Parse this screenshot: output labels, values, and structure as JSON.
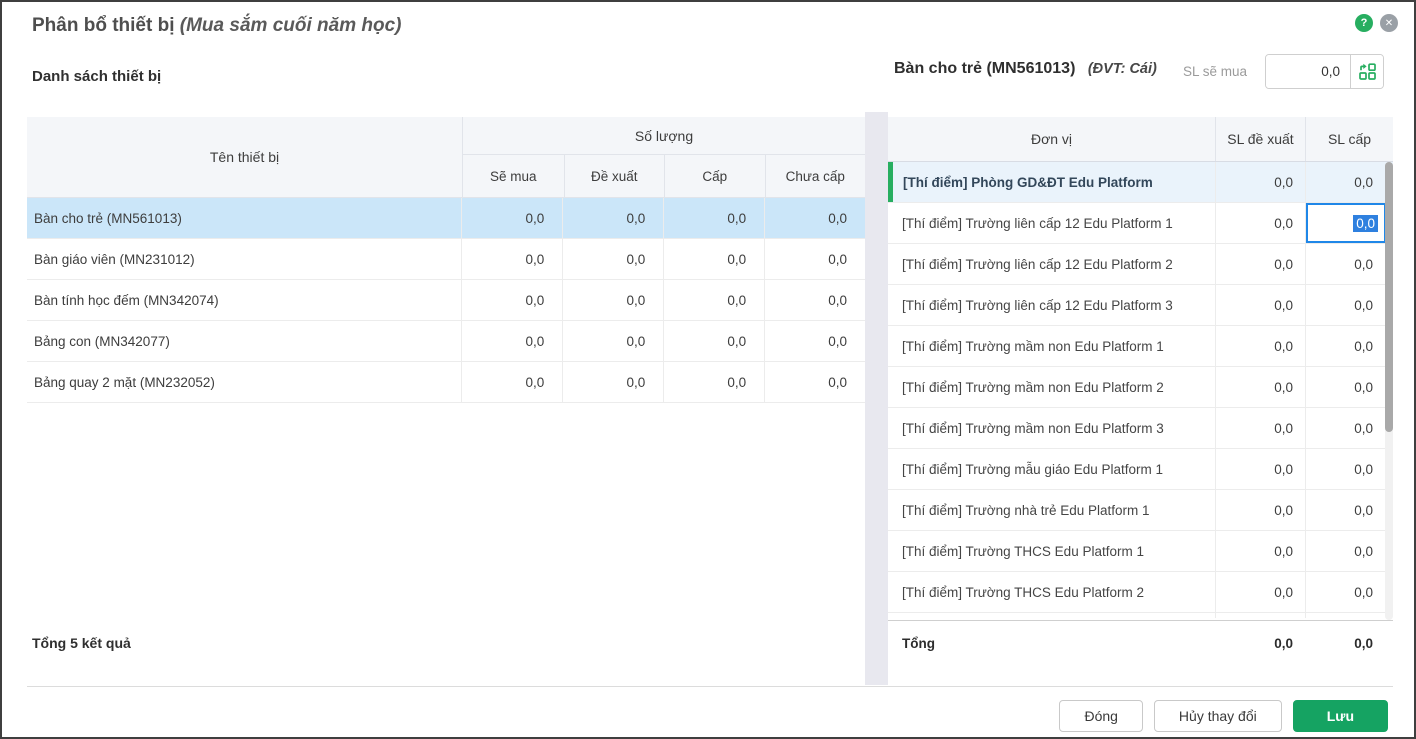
{
  "dialog": {
    "title": "Phân bổ thiết bị",
    "title_suffix": "(Mua sắm cuối năm học)",
    "help_icon": "?",
    "close_icon": "✕"
  },
  "left_panel": {
    "heading": "Danh sách thiết bị",
    "table": {
      "col_name": "Tên thiết bị",
      "col_group": "Số lượng",
      "subcols": [
        "Sẽ mua",
        "Đề xuất",
        "Cấp",
        "Chưa cấp"
      ],
      "rows": [
        {
          "name": "Bàn cho trẻ (MN561013)",
          "se_mua": "0,0",
          "de_xuat": "0,0",
          "cap": "0,0",
          "chua_cap": "0,0",
          "selected": true
        },
        {
          "name": "Bàn giáo viên (MN231012)",
          "se_mua": "0,0",
          "de_xuat": "0,0",
          "cap": "0,0",
          "chua_cap": "0,0",
          "selected": false
        },
        {
          "name": "Bàn tính học đếm (MN342074)",
          "se_mua": "0,0",
          "de_xuat": "0,0",
          "cap": "0,0",
          "chua_cap": "0,0",
          "selected": false
        },
        {
          "name": "Bảng con (MN342077)",
          "se_mua": "0,0",
          "de_xuat": "0,0",
          "cap": "0,0",
          "chua_cap": "0,0",
          "selected": false
        },
        {
          "name": "Bảng quay 2 mặt (MN232052)",
          "se_mua": "0,0",
          "de_xuat": "0,0",
          "cap": "0,0",
          "chua_cap": "0,0",
          "selected": false
        }
      ]
    },
    "footer_total": "Tổng 5 kết quả"
  },
  "right_panel": {
    "device_title": "Bàn cho trẻ (MN561013)",
    "device_unit": "(ĐVT: Cái)",
    "qty_label": "SL sẽ mua",
    "qty_value": "0,0",
    "distribute_icon": "grid-distribute-icon",
    "table": {
      "columns": [
        "Đơn vị",
        "SL đề xuất",
        "SL cấp"
      ],
      "rows": [
        {
          "name": "[Thí điểm] Phòng GD&ĐT Edu Platform",
          "de_xuat": "0,0",
          "cap": "0,0",
          "highlight": true,
          "cap_focused": false
        },
        {
          "name": "[Thí điểm] Trường liên cấp 12 Edu Platform 1",
          "de_xuat": "0,0",
          "cap": "0,0",
          "highlight": false,
          "cap_focused": true
        },
        {
          "name": "[Thí điểm] Trường liên cấp 12 Edu Platform 2",
          "de_xuat": "0,0",
          "cap": "0,0",
          "highlight": false,
          "cap_focused": false
        },
        {
          "name": "[Thí điểm] Trường liên cấp 12 Edu Platform 3",
          "de_xuat": "0,0",
          "cap": "0,0",
          "highlight": false,
          "cap_focused": false
        },
        {
          "name": "[Thí điểm] Trường mầm non Edu Platform 1",
          "de_xuat": "0,0",
          "cap": "0,0",
          "highlight": false,
          "cap_focused": false
        },
        {
          "name": "[Thí điểm] Trường mầm non Edu Platform 2",
          "de_xuat": "0,0",
          "cap": "0,0",
          "highlight": false,
          "cap_focused": false
        },
        {
          "name": "[Thí điểm] Trường mầm non Edu Platform 3",
          "de_xuat": "0,0",
          "cap": "0,0",
          "highlight": false,
          "cap_focused": false
        },
        {
          "name": "[Thí điểm] Trường mẫu giáo Edu Platform 1",
          "de_xuat": "0,0",
          "cap": "0,0",
          "highlight": false,
          "cap_focused": false
        },
        {
          "name": "[Thí điểm] Trường nhà trẻ Edu Platform 1",
          "de_xuat": "0,0",
          "cap": "0,0",
          "highlight": false,
          "cap_focused": false
        },
        {
          "name": "[Thí điểm] Trường THCS Edu Platform 1",
          "de_xuat": "0,0",
          "cap": "0,0",
          "highlight": false,
          "cap_focused": false
        },
        {
          "name": "[Thí điểm] Trường THCS Edu Platform 2",
          "de_xuat": "0,0",
          "cap": "0,0",
          "highlight": false,
          "cap_focused": false
        }
      ],
      "total_label": "Tổng",
      "total_de_xuat": "0,0",
      "total_cap": "0,0"
    }
  },
  "footer": {
    "close_label": "Đóng",
    "cancel_label": "Hủy thay đổi",
    "save_label": "Lưu"
  },
  "colors": {
    "accent_green": "#27ae60",
    "save_green": "#15a362",
    "selected_row_blue": "#cbe6f9",
    "highlight_row_blue": "#eaf3fb",
    "focus_border_blue": "#1f87e8",
    "text_selection_blue": "#2e80df"
  }
}
